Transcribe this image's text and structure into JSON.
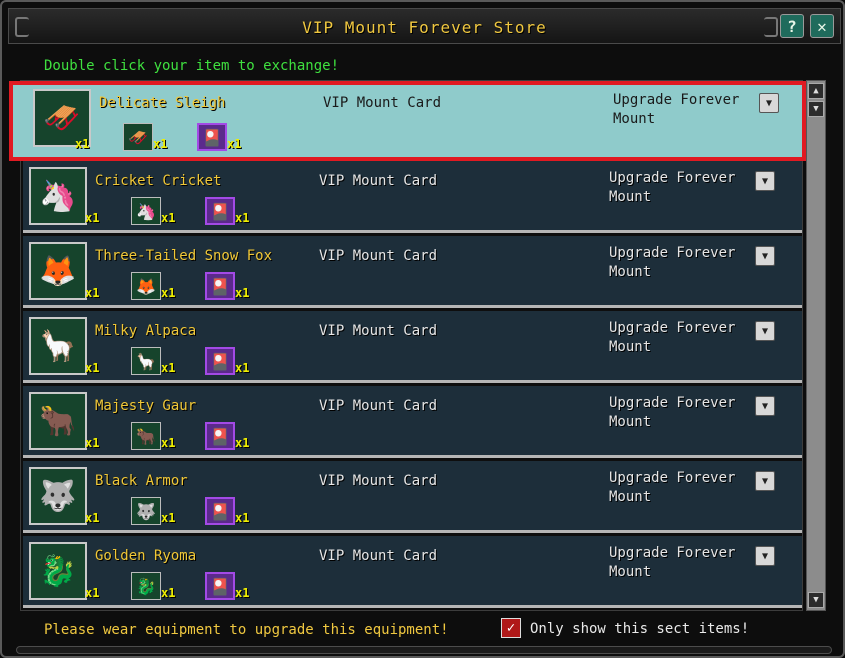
{
  "window": {
    "title": "VIP Mount Forever Store",
    "help_label": "?",
    "close_label": "✕"
  },
  "instruction": "Double click your item to exchange!",
  "items": [
    {
      "name": "Delicate Sleigh",
      "card": "VIP Mount Card",
      "upgrade": "Upgrade Forever Mount",
      "icon": "🛷",
      "mount_qty": "x1",
      "small_qty": "x1",
      "card_qty": "x1"
    },
    {
      "name": "Cricket Cricket",
      "card": "VIP Mount Card",
      "upgrade": "Upgrade Forever Mount",
      "icon": "🦄",
      "mount_qty": "x1",
      "small_qty": "x1",
      "card_qty": "x1"
    },
    {
      "name": "Three-Tailed Snow Fox",
      "card": "VIP Mount Card",
      "upgrade": "Upgrade Forever Mount",
      "icon": "🦊",
      "mount_qty": "x1",
      "small_qty": "x1",
      "card_qty": "x1"
    },
    {
      "name": "Milky Alpaca",
      "card": "VIP Mount Card",
      "upgrade": "Upgrade Forever Mount",
      "icon": "🦙",
      "mount_qty": "x1",
      "small_qty": "x1",
      "card_qty": "x1"
    },
    {
      "name": "Majesty Gaur",
      "card": "VIP Mount Card",
      "upgrade": "Upgrade Forever Mount",
      "icon": "🐂",
      "mount_qty": "x1",
      "small_qty": "x1",
      "card_qty": "x1"
    },
    {
      "name": "Black Armor",
      "card": "VIP Mount Card",
      "upgrade": "Upgrade Forever Mount",
      "icon": "🐺",
      "mount_qty": "x1",
      "small_qty": "x1",
      "card_qty": "x1"
    },
    {
      "name": "Golden Ryoma",
      "card": "VIP Mount Card",
      "upgrade": "Upgrade Forever Mount",
      "icon": "🐉",
      "mount_qty": "x1",
      "small_qty": "x1",
      "card_qty": "x1"
    }
  ],
  "card_icon": "🎴",
  "footer": {
    "warning": "Please wear equipment to upgrade this equipment!",
    "checkbox_label": "Only show this sect items!",
    "checkbox_mark": "✓"
  },
  "colors": {
    "title": "#f0c840",
    "instruction": "#3fe03f",
    "row_bg": "#1d2e3a",
    "selected_bg": "#8fcbcb",
    "selection_border": "#e01a22"
  }
}
